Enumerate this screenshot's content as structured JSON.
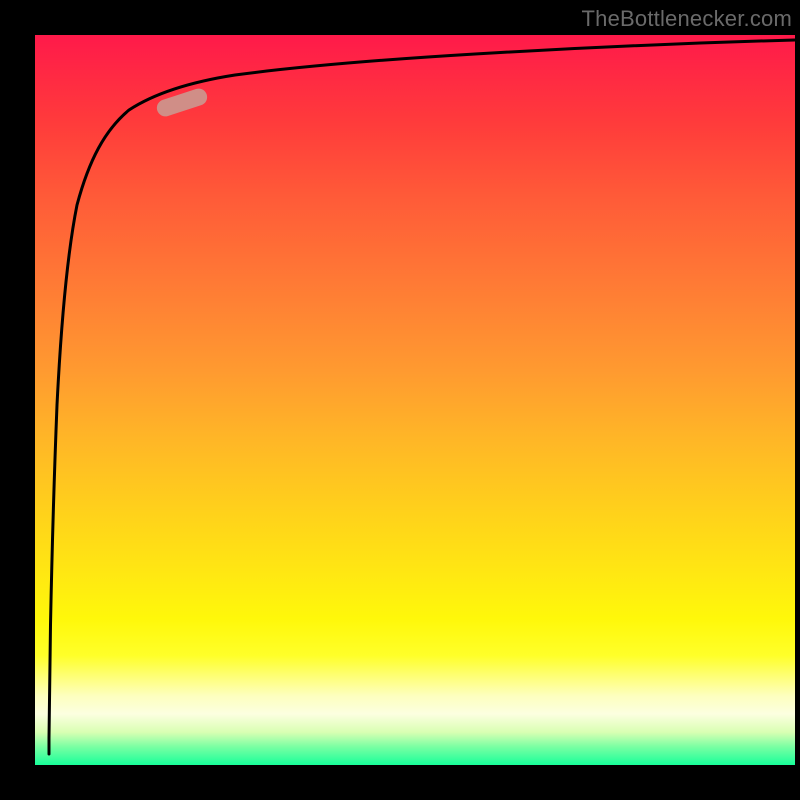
{
  "attribution": "TheBottlenecker.com",
  "colors": {
    "bg": "#000000",
    "gradient_top": "#ff1a4a",
    "gradient_bottom": "#18ff9a",
    "curve": "#000000",
    "pill": "#d08e87"
  },
  "chart_data": {
    "type": "line",
    "title": "",
    "xlabel": "",
    "ylabel": "",
    "xlim": [
      0,
      100
    ],
    "ylim": [
      0,
      100
    ],
    "series": [
      {
        "name": "curve",
        "x": [
          0.5,
          0.7,
          0.9,
          1.1,
          1.4,
          1.8,
          2.3,
          3,
          4,
          5.5,
          8,
          12,
          18,
          26,
          36,
          50,
          66,
          82,
          100
        ],
        "y": [
          2,
          10,
          24,
          38,
          52,
          64,
          74,
          81,
          86,
          89.5,
          92,
          93.5,
          94.7,
          95.5,
          96.2,
          96.8,
          97.3,
          97.6,
          98
        ]
      }
    ],
    "marker": {
      "name": "pill-highlight",
      "at_x_pct": 18.5,
      "at_y_pct_from_top": 9.5,
      "angle_deg": -18
    }
  }
}
